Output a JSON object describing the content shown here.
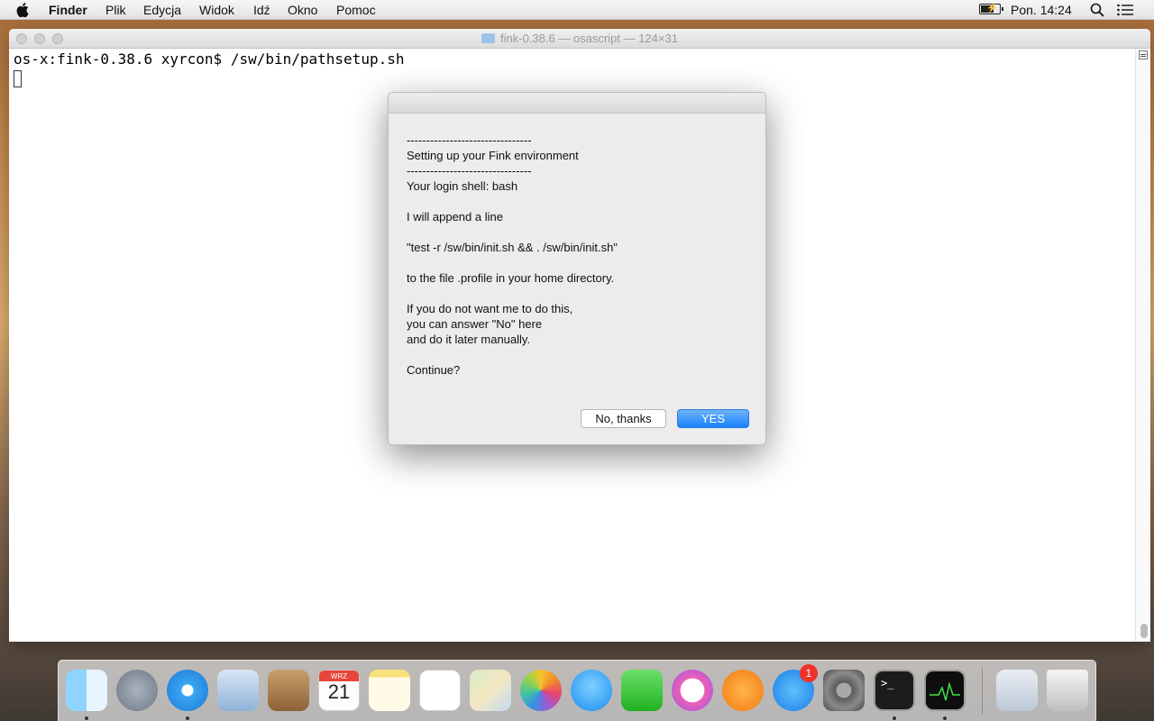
{
  "menubar": {
    "app_name": "Finder",
    "items": [
      "Plik",
      "Edycja",
      "Widok",
      "Idź",
      "Okno",
      "Pomoc"
    ],
    "clock": "Pon. 14:24"
  },
  "terminal": {
    "title": "fink-0.38.6 — osascript — 124×31",
    "prompt_line": "os-x:fink-0.38.6 xyrcon$ /sw/bin/pathsetup.sh"
  },
  "dialog": {
    "lines": [
      "--------------------------------",
      "Setting up your Fink environment",
      "--------------------------------",
      "Your login shell: bash",
      "",
      "I will append a line",
      "",
      "\"test -r /sw/bin/init.sh && . /sw/bin/init.sh\"",
      "",
      "to the file .profile in your home directory.",
      "",
      "If you do not want me to do this,",
      "you can answer \"No\" here",
      "and do it later manually.",
      "",
      "Continue?"
    ],
    "button_no": "No, thanks",
    "button_yes": "YES"
  },
  "dock": {
    "apps": [
      "finder-icon",
      "launchpad-icon",
      "safari-icon",
      "mail-icon",
      "contacts-icon",
      "calendar-icon",
      "notes-icon",
      "reminders-icon",
      "maps-icon",
      "photos-icon",
      "messages-icon",
      "facetime-icon",
      "itunes-icon",
      "ibooks-icon",
      "app-store-icon",
      "system-preferences-icon",
      "terminal-icon",
      "activity-monitor-icon",
      "downloads-stack-icon",
      "trash-icon"
    ],
    "calendar_month": "WRZ",
    "calendar_day": "21",
    "app_store_badge": "1"
  },
  "colors": {
    "accent": "#1a82fb",
    "badge": "#f0322b"
  }
}
